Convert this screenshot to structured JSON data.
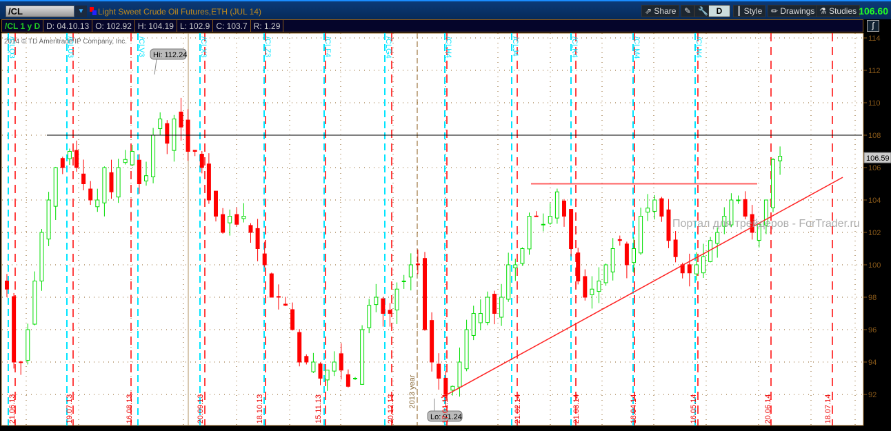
{
  "header": {
    "symbol": "/CL",
    "title": "Light Sweet Crude Oil Futures,ETH (JUL 14)",
    "buttons": [
      "Share",
      "D",
      "Style",
      "Drawings",
      "Studies"
    ],
    "last_price": "106.60"
  },
  "info": {
    "label": "/CL 1 y D",
    "date": "D: 04.10.13",
    "open": "O: 102.92",
    "high": "H: 104.19",
    "low": "L: 102.9",
    "close": "C: 103.7",
    "range": "R: 1.29"
  },
  "copyright": "2014 © TD Ameritrade IP Company, Inc.",
  "watermark": "Портал для трейдеров - ForTrader.ru",
  "colors": {
    "up": "#00dd00",
    "down": "#ff0000",
    "roll": "#00e5ff",
    "expiry": "#ff0000",
    "bg": "#ffffff"
  },
  "chart_data": {
    "type": "candlestick",
    "ylim": [
      90.5,
      114.3
    ],
    "yticks": [
      92,
      94,
      96,
      98,
      100,
      102,
      104,
      106,
      108,
      110,
      112,
      114
    ],
    "x_labels": [
      "21.06.13",
      "19.07.13",
      "16.08.13",
      "20.09.13",
      "18.10.13",
      "15.11.13",
      "20.12.13",
      "2013 year",
      "17.01.14",
      "21.02.14",
      "21.03.14",
      "18.04.14",
      "16.05.14",
      "20.06.14",
      "18.07.14"
    ],
    "contracts": [
      "/CLQ3",
      "/CLU3",
      "/CLV3",
      "/CLX3",
      "/CLZ3",
      "/CLF4",
      "/CLG4",
      "/CLH4",
      "/CLJ4",
      "/CLK4",
      "/CLM4",
      "/CLN4"
    ],
    "closes": [
      98.5,
      94,
      94,
      96,
      99,
      102,
      104,
      106,
      106,
      107,
      106,
      105,
      104,
      104,
      106,
      104.5,
      106,
      106.5,
      107,
      105,
      105.5,
      108,
      109,
      107.5,
      109,
      108.5,
      107,
      107,
      106,
      104,
      103,
      102,
      103,
      102.5,
      103,
      102,
      101,
      100,
      98,
      98,
      97.5,
      96,
      94,
      94,
      94,
      93,
      93.5,
      94,
      93.5,
      92.5,
      93,
      96,
      97.5,
      98,
      97,
      97,
      98.5,
      99,
      100,
      100,
      96,
      94,
      93,
      92,
      92.5,
      94,
      96,
      97,
      97,
      98,
      97,
      98,
      100,
      100,
      101,
      103,
      103,
      102.5,
      103,
      104.5,
      103,
      101,
      99,
      98,
      98.5,
      99,
      100,
      101,
      101.5,
      100,
      101,
      103,
      103.5,
      104,
      103,
      101.5,
      100.5,
      99.5,
      99.5,
      100,
      100.5,
      101.5,
      102,
      103,
      104,
      104,
      103,
      102,
      102.5,
      104,
      106.5,
      106.7
    ],
    "high_label": "Hi: 112.24",
    "low_label": "Lo: 91.24",
    "current_label": "106.59",
    "hlines": [
      {
        "price": 108,
        "color": "#000000"
      },
      {
        "price": 105,
        "color": "#ff6060"
      }
    ],
    "trendline": {
      "from_price": 91.8,
      "to_price": 105.4
    }
  }
}
